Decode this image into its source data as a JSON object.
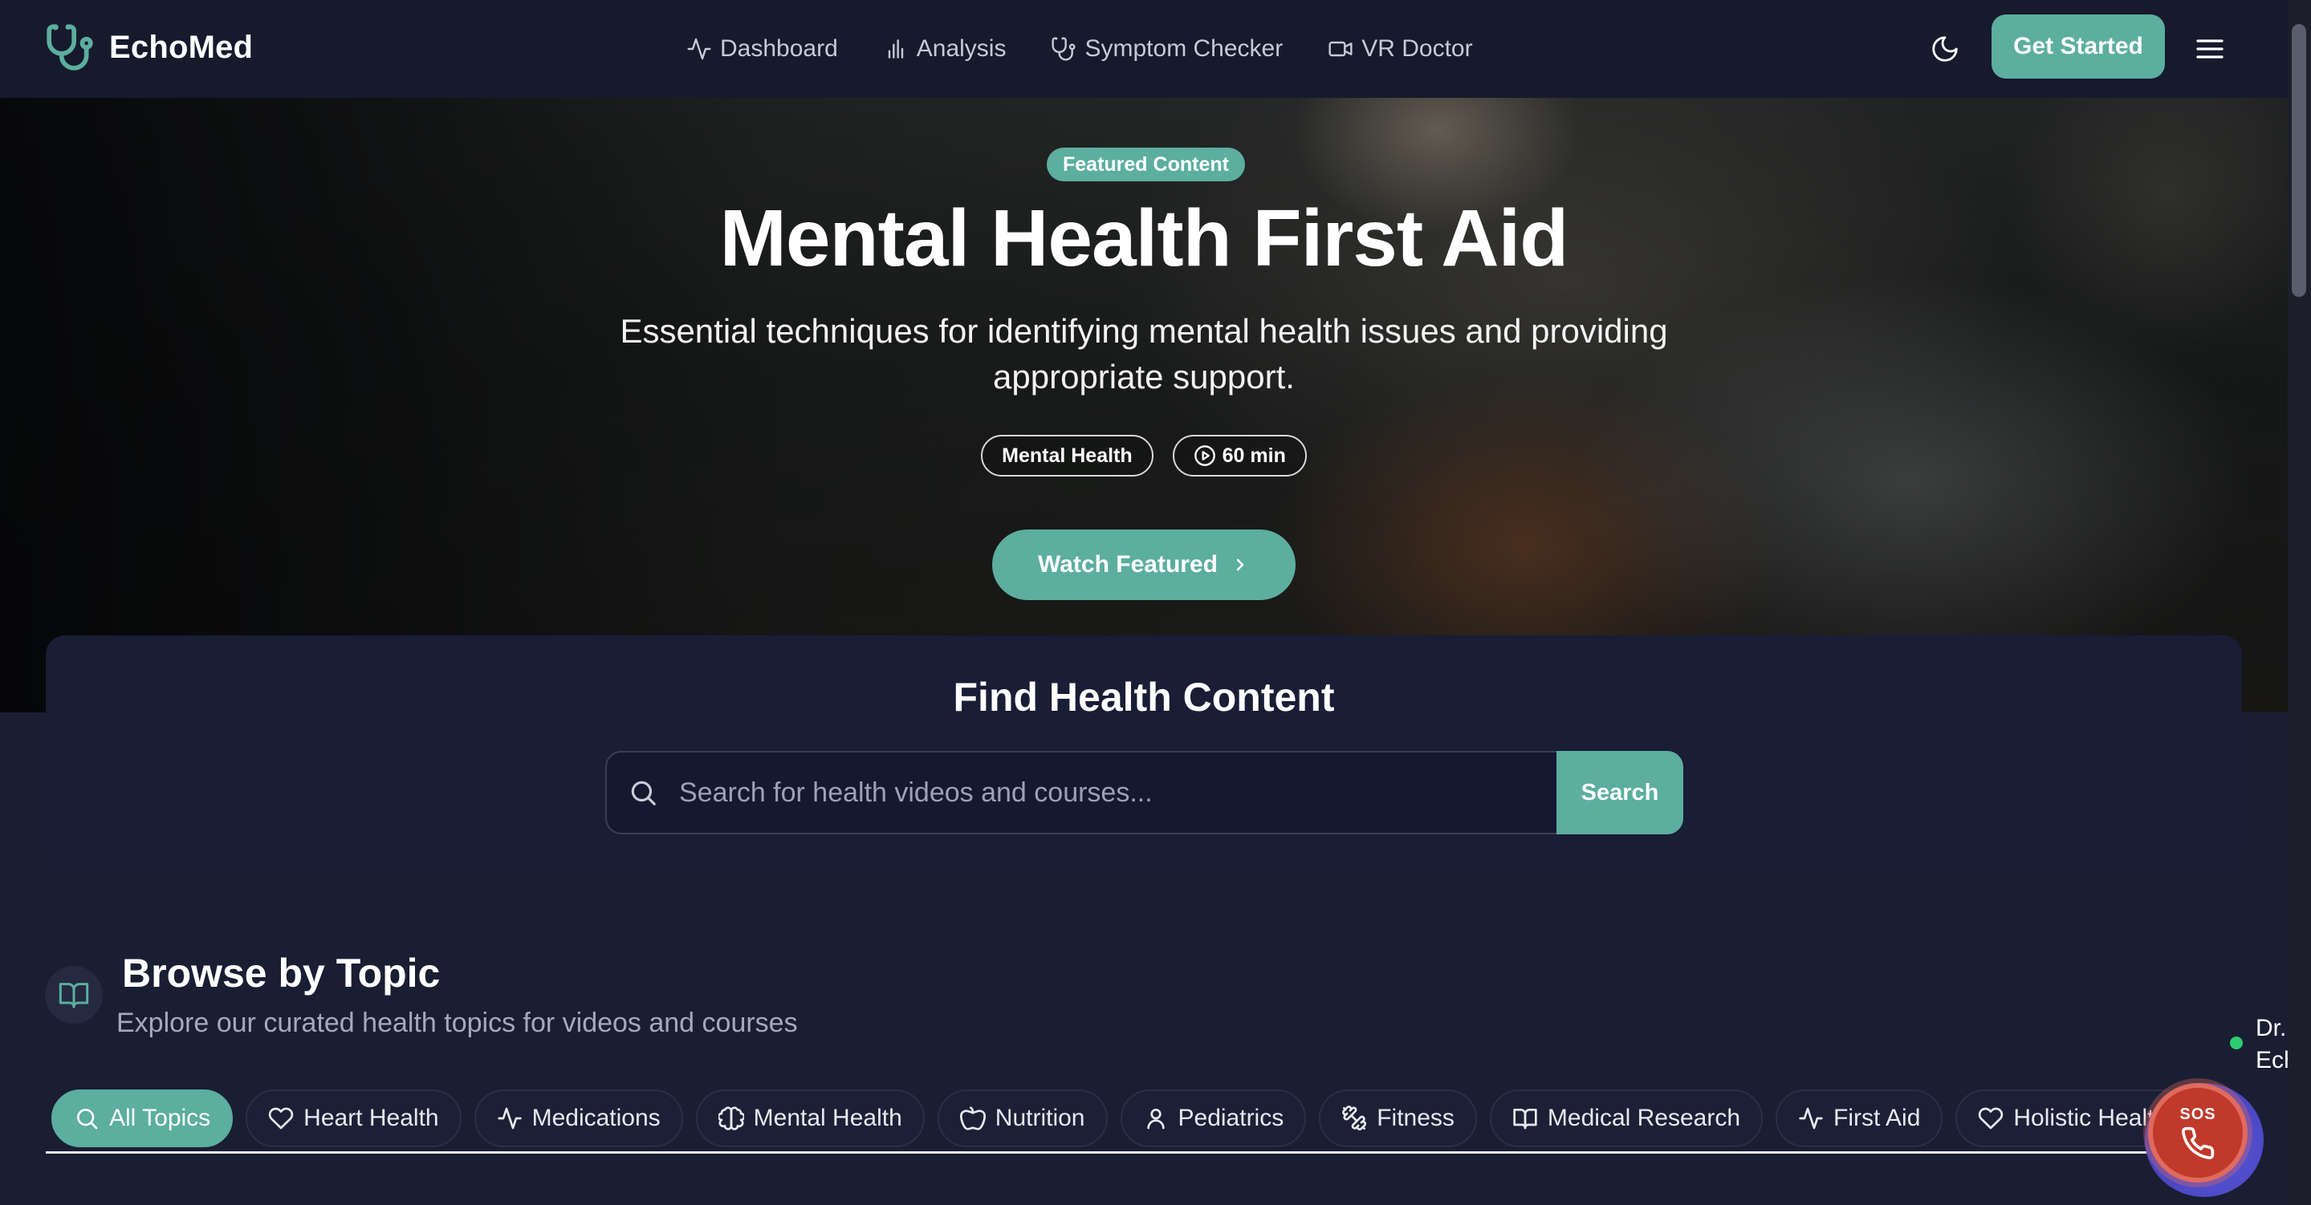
{
  "brand": {
    "name": "EchoMed",
    "accent": "#5cae9f"
  },
  "nav": {
    "links": [
      {
        "label": "Dashboard",
        "icon": "activity-icon"
      },
      {
        "label": "Analysis",
        "icon": "bar-chart-icon"
      },
      {
        "label": "Symptom Checker",
        "icon": "stethoscope-icon"
      },
      {
        "label": "VR Doctor",
        "icon": "video-camera-icon"
      }
    ],
    "theme_icon": "moon-icon",
    "cta": "Get Started",
    "menu_icon": "hamburger-menu-icon"
  },
  "hero": {
    "badge": "Featured Content",
    "title": "Mental Health First Aid",
    "subtitle": "Essential techniques for identifying mental health issues and providing appropriate support.",
    "tags": [
      {
        "label": "Mental Health"
      },
      {
        "label": "60 min",
        "icon": "play-circle-icon"
      }
    ],
    "button": "Watch Featured"
  },
  "search": {
    "title": "Find Health Content",
    "placeholder": "Search for health videos and courses...",
    "value": "",
    "button": "Search"
  },
  "topics": {
    "title": "Browse by Topic",
    "subtitle": "Explore our curated health topics for videos and courses",
    "items": [
      {
        "label": "All Topics",
        "icon": "search-icon",
        "active": true
      },
      {
        "label": "Heart Health",
        "icon": "heart-icon",
        "active": false
      },
      {
        "label": "Medications",
        "icon": "activity-icon",
        "active": false
      },
      {
        "label": "Mental Health",
        "icon": "brain-icon",
        "active": false
      },
      {
        "label": "Nutrition",
        "icon": "apple-icon",
        "active": false
      },
      {
        "label": "Pediatrics",
        "icon": "user-icon",
        "active": false
      },
      {
        "label": "Fitness",
        "icon": "dumbbell-icon",
        "active": false
      },
      {
        "label": "Medical Research",
        "icon": "book-open-icon",
        "active": false
      },
      {
        "label": "First Aid",
        "icon": "activity-icon",
        "active": false
      },
      {
        "label": "Holistic Health",
        "icon": "heart-icon",
        "active": false
      }
    ]
  },
  "assistant": {
    "label_line1": "Dr.",
    "label_line2": "Ech",
    "status_color": "#2ecc71"
  },
  "sos": {
    "label": "SOS",
    "icon": "phone-icon"
  }
}
